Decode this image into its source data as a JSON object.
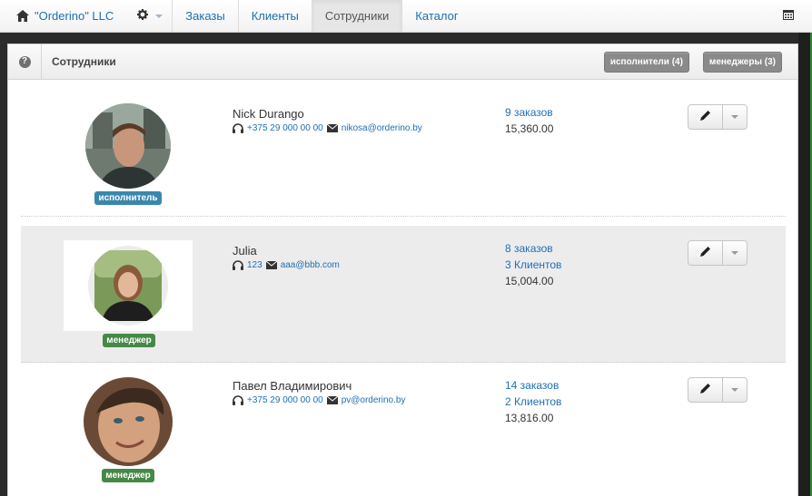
{
  "navbar": {
    "brand": "\"Orderino\" LLC",
    "tabs": [
      {
        "label": "Заказы",
        "active": false
      },
      {
        "label": "Клиенты",
        "active": false
      },
      {
        "label": "Сотрудники",
        "active": true
      },
      {
        "label": "Каталог",
        "active": false
      }
    ],
    "icons": [
      "home-icon",
      "gear-icon",
      "calendar-icon"
    ]
  },
  "panel": {
    "title": "Сотрудники",
    "help_icon": "?",
    "filters": [
      {
        "label": "исполнители (4)"
      },
      {
        "label": "менеджеры (3)"
      }
    ]
  },
  "employees": [
    {
      "name": "Nick Durango",
      "phone": "+375 29 000 00 00",
      "email": "nikosa@orderino.by",
      "role": "исполнитель",
      "role_color": "#3a87ad",
      "orders": "9 заказов",
      "clients": "",
      "amount": "15,360.00"
    },
    {
      "name": "Julia",
      "phone": "123",
      "email": "aaa@bbb.com",
      "role": "менеджер",
      "role_color": "#468847",
      "orders": "8 заказов",
      "clients": "3 Клиентов",
      "amount": "15,004.00"
    },
    {
      "name": "Павел Владимирович",
      "phone": "+375 29 000 00 00",
      "email": "pv@orderino.by",
      "role": "менеджер",
      "role_color": "#468847",
      "orders": "14 заказов",
      "clients": "2 Клиентов",
      "amount": "13,816.00"
    }
  ],
  "colors": {
    "link": "#1e6fb3",
    "badge_blue": "#3a87ad",
    "badge_green": "#468847",
    "filter_button": "#8a8a8a"
  }
}
